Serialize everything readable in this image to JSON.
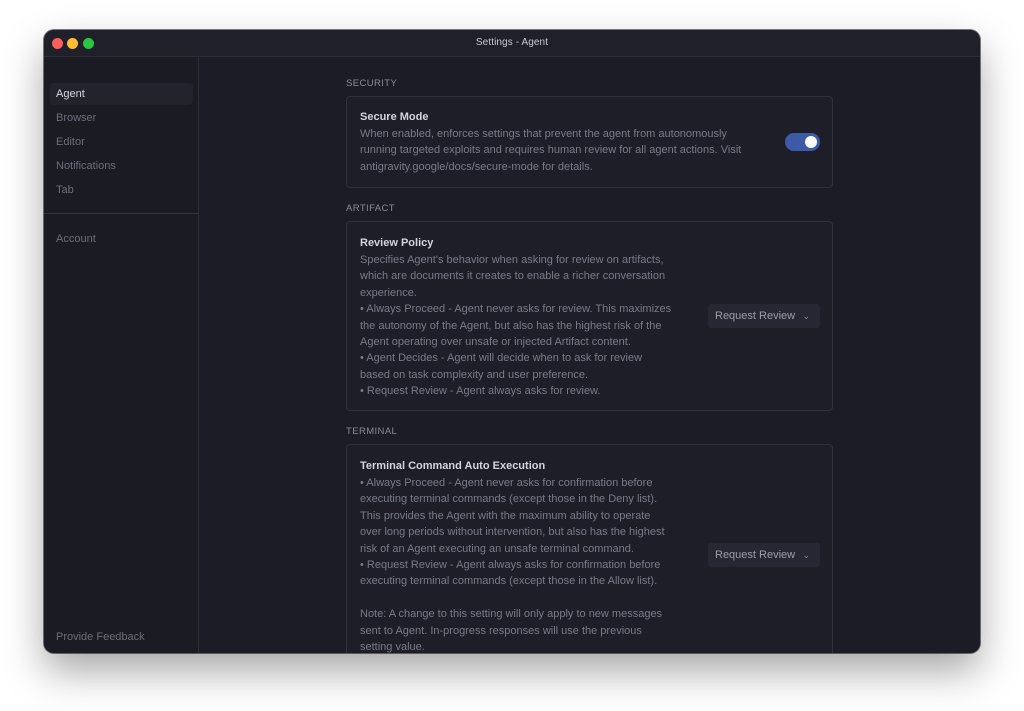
{
  "window": {
    "title": "Settings - Agent"
  },
  "sidebar": {
    "items": [
      {
        "label": "Agent",
        "active": true
      },
      {
        "label": "Browser"
      },
      {
        "label": "Editor"
      },
      {
        "label": "Notifications"
      },
      {
        "label": "Tab"
      }
    ],
    "account": "Account",
    "feedback": "Provide Feedback"
  },
  "sections": {
    "security": {
      "label": "SECURITY",
      "title": "Secure Mode",
      "desc": "When enabled, enforces settings that prevent the agent from autonomously\nrunning targeted exploits and requires human review for all agent actions. Visit\nantigravity.google/docs/secure-mode for details.",
      "toggle_on": true
    },
    "artifact": {
      "label": "ARTIFACT",
      "title": "Review Policy",
      "desc": "Specifies Agent's behavior when asking for review on artifacts,\nwhich are documents it creates to enable a richer conversation\nexperience.\n• Always Proceed - Agent never asks for review. This maximizes\nthe autonomy of the Agent, but also has the highest risk of the\nAgent operating over unsafe or injected Artifact content.\n• Agent Decides - Agent will decide when to ask for review\nbased on task complexity and user preference.\n• Request Review - Agent always asks for review.",
      "select_value": "Request Review"
    },
    "terminal": {
      "label": "TERMINAL",
      "title": "Terminal Command Auto Execution",
      "desc": "• Always Proceed - Agent never asks for confirmation before\nexecuting terminal commands (except those in the Deny list).\nThis provides the Agent with the maximum ability to operate\nover long periods without intervention, but also has the highest\nrisk of an Agent executing an unsafe terminal command.\n• Request Review - Agent always asks for confirmation before\nexecuting terminal commands (except those in the Allow list).\n\nNote: A change to this setting will only apply to new messages\nsent to Agent. In-progress responses will use the previous\nsetting value.",
      "select_value": "Request Review"
    }
  },
  "icons": {
    "chevron": "chevron-down-icon",
    "close": "close-window-icon",
    "minimize": "minimize-window-icon",
    "zoom": "zoom-window-icon"
  },
  "colors": {
    "accent": "#3d5aa6",
    "background": "#1b1c26",
    "sidebar": "#1a1b23"
  }
}
